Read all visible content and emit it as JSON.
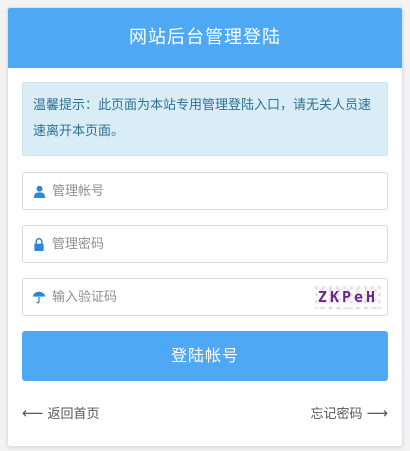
{
  "header": {
    "title": "网站后台管理登陆"
  },
  "notice": {
    "text": "温馨提示：此页面为本站专用管理登陆入口，请无关人员速速离开本页面。"
  },
  "form": {
    "username": {
      "placeholder": "管理帐号",
      "value": ""
    },
    "password": {
      "placeholder": "管理密码",
      "value": ""
    },
    "captcha": {
      "placeholder": "输入验证码",
      "value": "",
      "image_text": "ZKPeH"
    },
    "submit_label": "登陆帐号"
  },
  "footer": {
    "back_label": "返回首页",
    "forgot_label": "忘记密码"
  },
  "colors": {
    "accent": "#4ea8f4",
    "icon": "#2b87d8",
    "notice_bg": "#d9edf7",
    "notice_text": "#31708f"
  },
  "icons": {
    "username": "user-icon",
    "password": "lock-icon",
    "captcha": "umbrella-icon",
    "back": "arrow-left-icon",
    "forgot": "arrow-right-icon"
  }
}
